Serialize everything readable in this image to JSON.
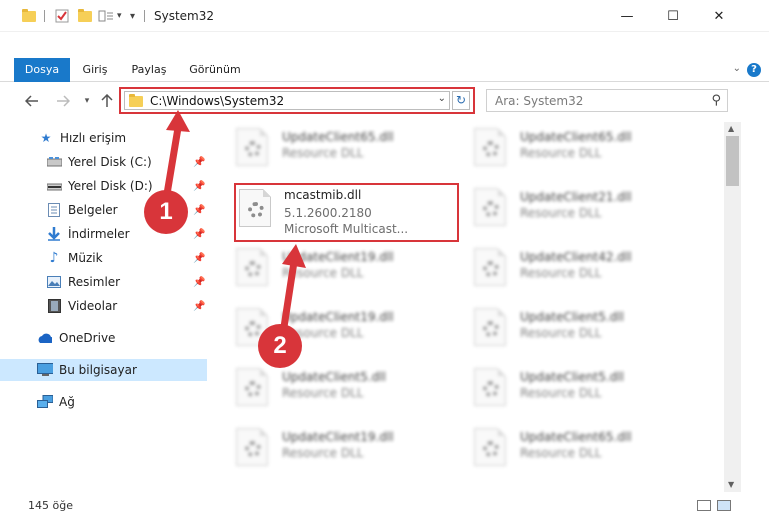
{
  "window": {
    "title": "System32",
    "quick_access_dropdown": "▾",
    "minimize": "—",
    "maximize": "☐",
    "close": "✕"
  },
  "ribbon": {
    "tabs": [
      "Dosya",
      "Giriş",
      "Paylaş",
      "Görünüm"
    ],
    "help": "?"
  },
  "address": {
    "path": "C:\\Windows\\System32",
    "search_placeholder": "Ara: System32"
  },
  "nav": {
    "items": [
      {
        "label": "Hızlı erişim",
        "icon": "star-icon"
      },
      {
        "label": "Yerel Disk (C:)",
        "icon": "drive-icon"
      },
      {
        "label": "Yerel Disk (D:)",
        "icon": "drive-icon"
      },
      {
        "label": "Belgeler",
        "icon": "documents-icon"
      },
      {
        "label": "İndirmeler",
        "icon": "download-icon"
      },
      {
        "label": "Müzik",
        "icon": "music-icon"
      },
      {
        "label": "Resimler",
        "icon": "pictures-icon"
      },
      {
        "label": "Videolar",
        "icon": "videos-icon"
      },
      {
        "label": "OneDrive",
        "icon": "cloud-icon"
      },
      {
        "label": "Bu bilgisayar",
        "icon": "computer-icon"
      },
      {
        "label": "Ağ",
        "icon": "network-icon"
      }
    ]
  },
  "files": {
    "selected": {
      "name": "mcastmib.dll",
      "version": "5.1.2600.2180",
      "description": "Microsoft Multicast..."
    },
    "left_column": [
      {
        "name": "UpdateClient65.dll",
        "type": "Resource DLL"
      },
      {
        "name": "UpdateClient19.dll",
        "type": "Resource DLL"
      },
      {
        "name": "UpdateClient19.dll",
        "type": "Resource DLL"
      },
      {
        "name": "UpdateClient5.dll",
        "type": "Resource DLL"
      },
      {
        "name": "UpdateClient19.dll",
        "type": "Resource DLL"
      }
    ],
    "right_column": [
      {
        "name": "UpdateClient65.dll",
        "type": "Resource DLL"
      },
      {
        "name": "UpdateClient21.dll",
        "type": "Resource DLL"
      },
      {
        "name": "UpdateClient42.dll",
        "type": "Resource DLL"
      },
      {
        "name": "UpdateClient5.dll",
        "type": "Resource DLL"
      },
      {
        "name": "UpdateClient5.dll",
        "type": "Resource DLL"
      },
      {
        "name": "UpdateClient65.dll",
        "type": "Resource DLL"
      }
    ]
  },
  "status": {
    "item_count": "145 öğe"
  },
  "annotations": {
    "step1": "1",
    "step2": "2",
    "color": "#d8353a"
  }
}
